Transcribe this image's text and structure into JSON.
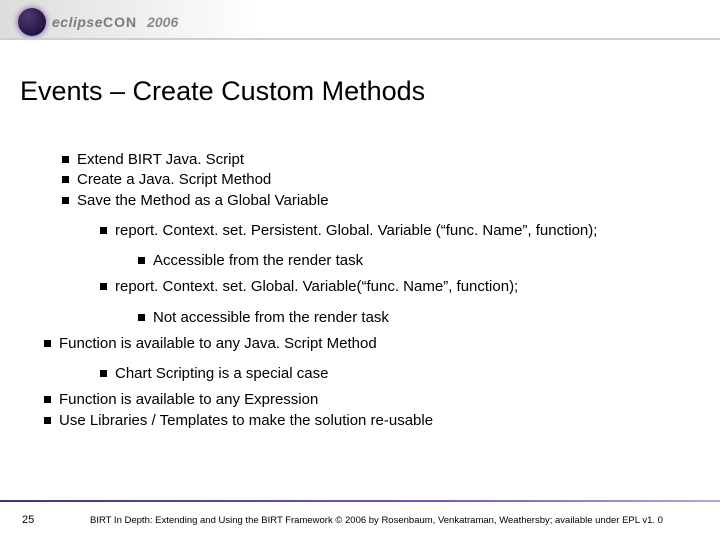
{
  "logo": {
    "brand": "eclipse",
    "con": "CON",
    "year": "2006"
  },
  "title": "Events – Create Custom Methods",
  "b": {
    "a1": "Extend BIRT Java. Script",
    "a2": "Create a Java. Script Method",
    "a3": "Save the Method as a Global Variable",
    "b1": "report. Context. set. Persistent. Global. Variable (“func. Name”, function);",
    "c1": "Accessible from the render task",
    "b2": "report. Context. set. Global. Variable(“func. Name”, function);",
    "c2": "Not accessible from the render task",
    "a4": "Function is available to any Java. Script Method",
    "b3": "Chart Scripting is a special case",
    "a5": "Function is available to any Expression",
    "a6": "Use Libraries / Templates to make the solution re-usable"
  },
  "footer": {
    "page": "25",
    "text": "BIRT In Depth: Extending and Using the BIRT Framework © 2006 by Rosenbaum, Venkatraman, Weathersby; available under EPL v1. 0"
  }
}
